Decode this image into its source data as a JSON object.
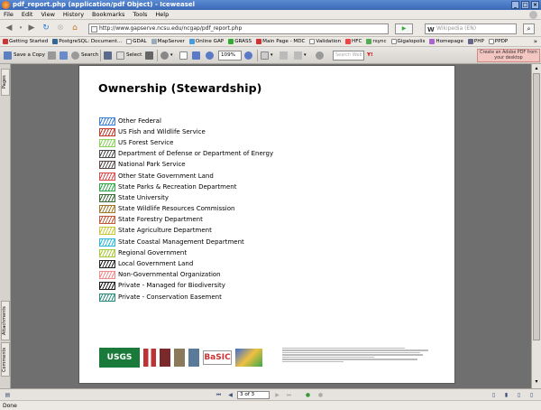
{
  "window": {
    "title": "pdf_report.php (application/pdf Object) - Iceweasel"
  },
  "menu": [
    "File",
    "Edit",
    "View",
    "History",
    "Bookmarks",
    "Tools",
    "Help"
  ],
  "navigation": {
    "url": "http://www.gapserve.ncsu.edu/ncgap/pdf_report.php",
    "search_placeholder": "Wikipedia (EN)"
  },
  "bookmarks": [
    "Getting Started",
    "PostgreSQL: Document...",
    "GDAL",
    "MapServer",
    "Online GAP",
    "GRASS",
    "Main Page - MDC",
    "Validation",
    "HFC",
    "rsync",
    "Gigalopolis",
    "Homepage",
    "PHP",
    "PPDP"
  ],
  "pdf_toolbar": {
    "save_copy": "Save a Copy",
    "search": "Search",
    "select": "Select",
    "zoom": "109%",
    "search_web_placeholder": "Search Web",
    "adobe_btn": "Create an Adobe PDF from your desktop",
    "side_tab_pages": "Pages",
    "side_tab_attachments": "Attachments",
    "side_tab_comments": "Comments"
  },
  "document": {
    "heading": "Ownership (Stewardship)",
    "legend": [
      {
        "label": "Other Federal",
        "color": "#3b7fd4"
      },
      {
        "label": "US Fish and Wildlife Service",
        "color": "#c0392b"
      },
      {
        "label": "US Forest Service",
        "color": "#8bd35a"
      },
      {
        "label": "Department of Defense or Department of Energy",
        "color": "#4a4a4a"
      },
      {
        "label": "National Park Service",
        "color": "#5a4a4a"
      },
      {
        "label": "Other State Government Land",
        "color": "#d94a4a"
      },
      {
        "label": "State Parks & Recreation Department",
        "color": "#2fa84a"
      },
      {
        "label": "State University",
        "color": "#3e6a3a"
      },
      {
        "label": "State Wildlife Resources Commission",
        "color": "#a0782a"
      },
      {
        "label": "State Forestry Department",
        "color": "#c05a3a"
      },
      {
        "label": "State Agriculture Department",
        "color": "#c8c83a"
      },
      {
        "label": "State Coastal Management Department",
        "color": "#2ab8d8"
      },
      {
        "label": "Regional Government",
        "color": "#a8c83a"
      },
      {
        "label": "Local Government Land",
        "color": "#222222"
      },
      {
        "label": "Non-Governmental Organization",
        "color": "#f08a8a"
      },
      {
        "label": "Private - Managed for Biodiversity",
        "color": "#1a1a1a"
      },
      {
        "label": "Private - Conservation Easement",
        "color": "#2a8a7a"
      }
    ],
    "logo_usgs": "USGS",
    "logo_basic": "BaSIC"
  },
  "pager": {
    "page_indicator": "3 of 3"
  },
  "status": "Done"
}
